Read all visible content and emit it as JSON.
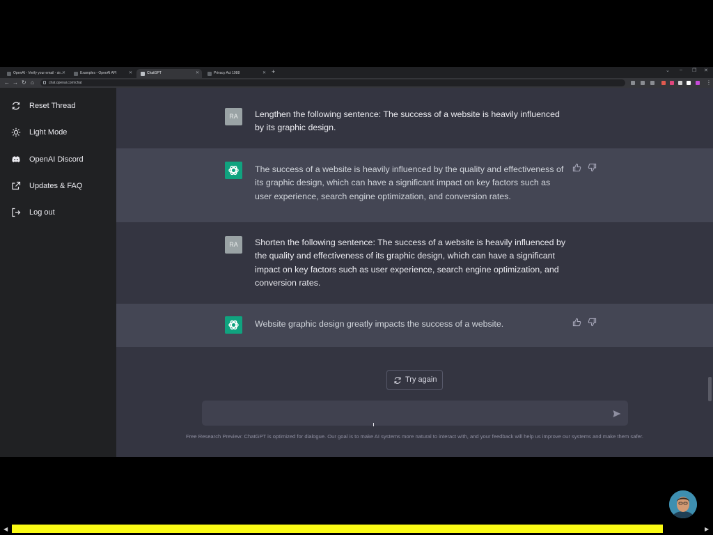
{
  "browser": {
    "tabs": [
      {
        "title": "OpenAI - Verify your email - sir...",
        "active": false
      },
      {
        "title": "Examples - OpenAI API",
        "active": false
      },
      {
        "title": "ChatGPT",
        "active": true
      },
      {
        "title": "Privacy Act 1988",
        "active": false
      }
    ],
    "url": "chat.openai.com/chat"
  },
  "sidebar": {
    "items": [
      {
        "label": "Reset Thread",
        "icon": "refresh-icon"
      },
      {
        "label": "Light Mode",
        "icon": "sun-icon"
      },
      {
        "label": "OpenAI Discord",
        "icon": "discord-icon"
      },
      {
        "label": "Updates & FAQ",
        "icon": "external-link-icon"
      },
      {
        "label": "Log out",
        "icon": "logout-icon"
      }
    ]
  },
  "conversation": [
    {
      "role": "user",
      "avatar": "RA",
      "text": "Lengthen the following sentence: The success of a website is heavily influenced by its graphic design."
    },
    {
      "role": "assistant",
      "text": "The success of a website is heavily influenced by the quality and effectiveness of its graphic design, which can have a significant impact on key factors such as user experience, search engine optimization, and conversion rates."
    },
    {
      "role": "user",
      "avatar": "RA",
      "text": "Shorten the following sentence: The success of a website is heavily influenced by the quality and effectiveness of its graphic design, which can have a significant impact on key factors such as user experience, search engine optimization, and conversion rates."
    },
    {
      "role": "assistant",
      "text": "Website graphic design greatly impacts the success of a website."
    }
  ],
  "try_again_label": "Try again",
  "composer": {
    "value": ""
  },
  "footer": "Free Research Preview: ChatGPT is optimized for dialogue. Our goal is to make AI systems more natural to interact with, and your feedback will help us improve our systems and make them safer.",
  "colors": {
    "page_bg": "#343541",
    "assistant_row_bg": "#444654",
    "sidebar_bg": "#202123",
    "assistant_avatar": "#10a37f",
    "user_avatar": "#9aa3a5",
    "progress_bar": "#fbfb14"
  }
}
